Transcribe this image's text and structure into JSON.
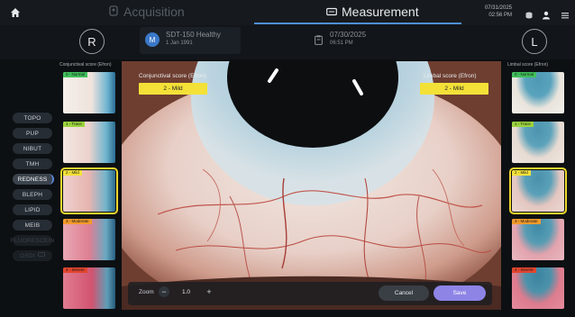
{
  "header": {
    "acquisition_label": "Acquisition",
    "measurement_label": "Measurement",
    "date": "07/31/2025",
    "time": "02:56 PM"
  },
  "patient": {
    "right_eye": "R",
    "left_eye": "L",
    "avatar_initial": "M",
    "name": "SDT-150 Healthy",
    "dob": "1 Jan 1991",
    "exam_date": "07/30/2025",
    "exam_time": "06:51 PM"
  },
  "menu": {
    "items": [
      {
        "label": "TOPO",
        "state": "normal"
      },
      {
        "label": "PUP",
        "state": "normal"
      },
      {
        "label": "NIBUT",
        "state": "normal"
      },
      {
        "label": "TMH",
        "state": "normal"
      },
      {
        "label": "REDNESS",
        "state": "active"
      },
      {
        "label": "BLEPH",
        "state": "normal"
      },
      {
        "label": "LIPID",
        "state": "normal"
      },
      {
        "label": "MEIB",
        "state": "normal"
      },
      {
        "label": "FLUORESCEIN",
        "state": "disabled"
      },
      {
        "label": "OSDI",
        "state": "disabled"
      }
    ]
  },
  "conjunctival": {
    "column_title": "Conjunctival score (Efron)",
    "score_label": "Conjunctival score (Efron)",
    "score_value": "2 - Mild",
    "grades": [
      {
        "label": "0 - Normal",
        "color": "#3fbf5a"
      },
      {
        "label": "1 - Trace",
        "color": "#9bd33c"
      },
      {
        "label": "2 - Mild",
        "color": "#f3e138"
      },
      {
        "label": "3 - Moderate",
        "color": "#f39a2a"
      },
      {
        "label": "4 - Severe",
        "color": "#e2452e"
      }
    ],
    "selected_grade": 2
  },
  "limbal": {
    "column_title": "Limbal score (Efron)",
    "score_label": "Limbal score (Efron)",
    "score_value": "2 - Mild",
    "grades": [
      {
        "label": "0 - Normal",
        "color": "#3fbf5a"
      },
      {
        "label": "1 - Trace",
        "color": "#9bd33c"
      },
      {
        "label": "2 - Mild",
        "color": "#f3e138"
      },
      {
        "label": "3 - Moderate",
        "color": "#f39a2a"
      },
      {
        "label": "4 - Severe",
        "color": "#e2452e"
      }
    ],
    "selected_grade": 2
  },
  "viewer": {
    "zoom_label": "Zoom",
    "zoom_value": "1.0",
    "minus": "−",
    "plus": "+",
    "cancel_label": "Cancel",
    "save_label": "Save"
  },
  "colors": {
    "accent_blue": "#4d8fd6",
    "selected_yellow": "#f3e138",
    "save_purple": "#8e84e6"
  }
}
